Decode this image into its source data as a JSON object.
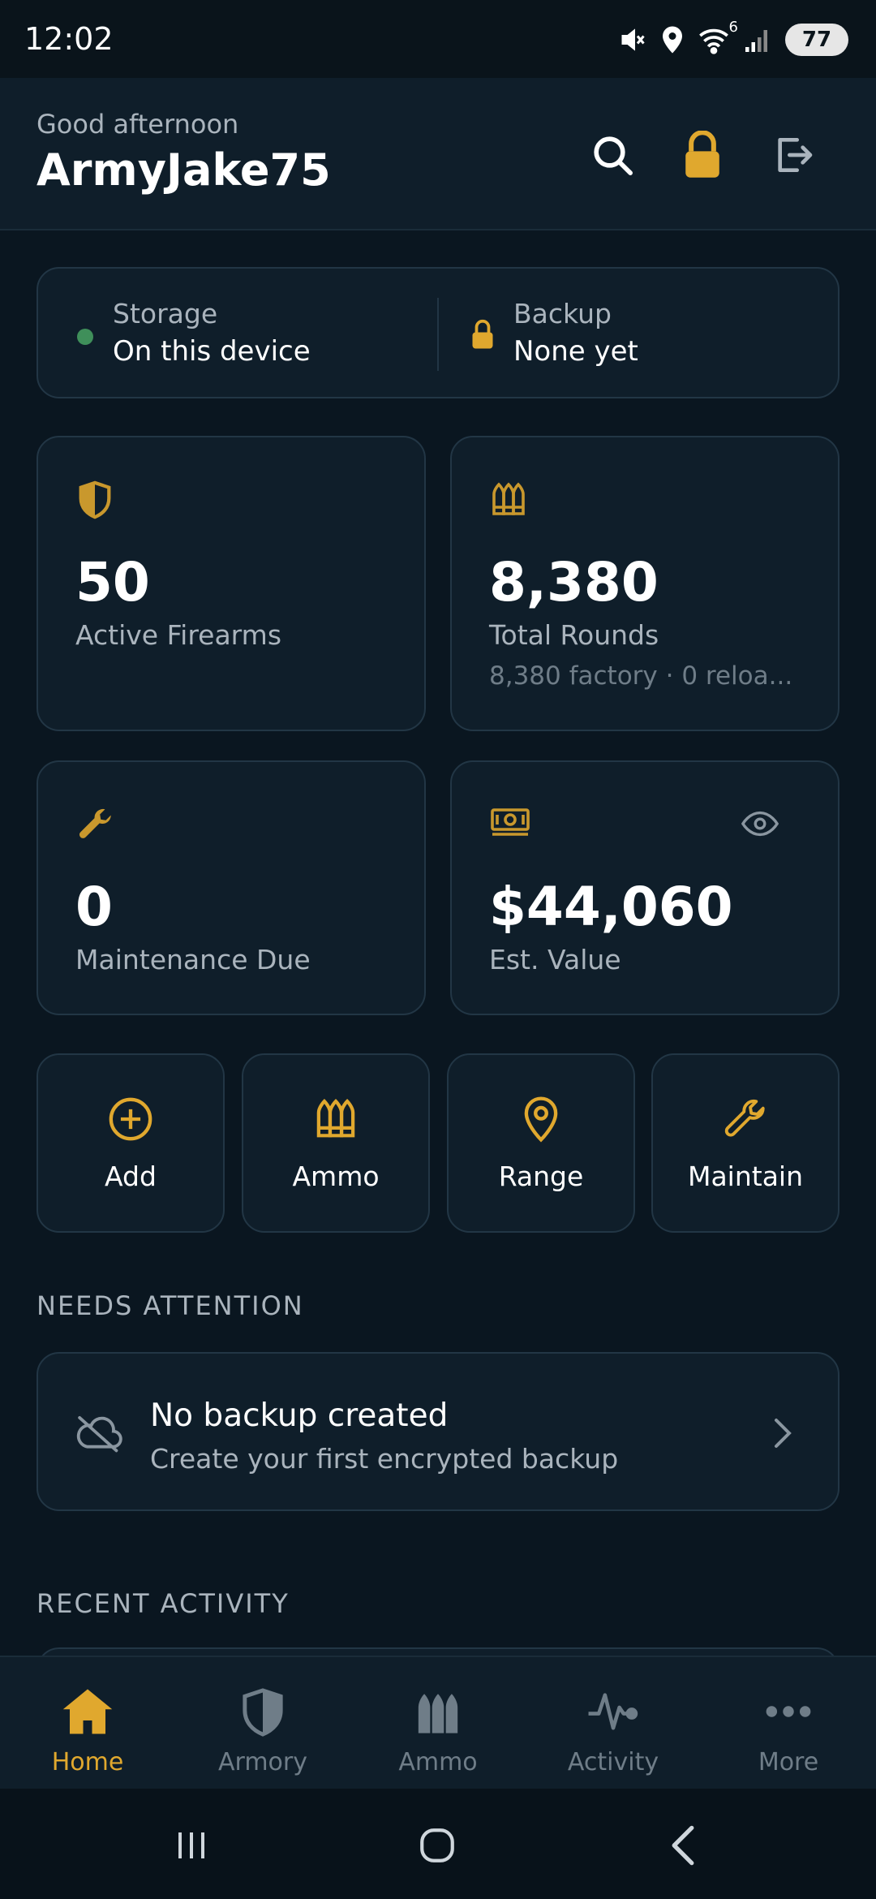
{
  "status_bar": {
    "time": "12:02",
    "battery": "77",
    "network_badge": "6",
    "icons": [
      "mute-icon",
      "location-icon",
      "wifi-icon",
      "signal-icon",
      "battery-icon"
    ]
  },
  "header": {
    "greeting": "Good afternoon",
    "username": "ArmyJake75",
    "actions": [
      "search-icon",
      "lock-icon",
      "logout-icon"
    ]
  },
  "storage": {
    "storage_label": "Storage",
    "storage_value": "On this device",
    "storage_status_color": "#3f8f5a",
    "backup_label": "Backup",
    "backup_value": "None yet"
  },
  "stats": {
    "firearms": {
      "value": "50",
      "label": "Active Firearms",
      "icon": "shield-icon"
    },
    "rounds": {
      "value": "8,380",
      "label": "Total Rounds",
      "sub": "8,380 factory · 0 reloa...",
      "icon": "ammo-icon"
    },
    "maintenance": {
      "value": "0",
      "label": "Maintenance Due",
      "icon": "wrench-icon"
    },
    "value": {
      "value": "$44,060",
      "label": "Est. Value",
      "icon": "money-icon"
    }
  },
  "quick_actions": [
    {
      "label": "Add",
      "icon": "plus-circle-icon"
    },
    {
      "label": "Ammo",
      "icon": "ammo-icon"
    },
    {
      "label": "Range",
      "icon": "location-pin-icon"
    },
    {
      "label": "Maintain",
      "icon": "wrench-icon"
    }
  ],
  "needs_attention": {
    "title": "NEEDS ATTENTION",
    "item_title": "No backup created",
    "item_subtitle": "Create your first encrypted backup",
    "icon": "cloud-off-icon"
  },
  "recent_activity": {
    "title": "RECENT ACTIVITY"
  },
  "bottom_nav": [
    {
      "label": "Home",
      "icon": "home-icon",
      "active": true
    },
    {
      "label": "Armory",
      "icon": "shield-icon",
      "active": false
    },
    {
      "label": "Ammo",
      "icon": "ammo-icon",
      "active": false
    },
    {
      "label": "Activity",
      "icon": "activity-icon",
      "active": false
    },
    {
      "label": "More",
      "icon": "more-icon",
      "active": false
    }
  ],
  "colors": {
    "accent": "#e0a82e",
    "background": "#0a1620",
    "card": "#0f1e2a",
    "border": "#223645",
    "muted_text": "#aab4bd"
  }
}
